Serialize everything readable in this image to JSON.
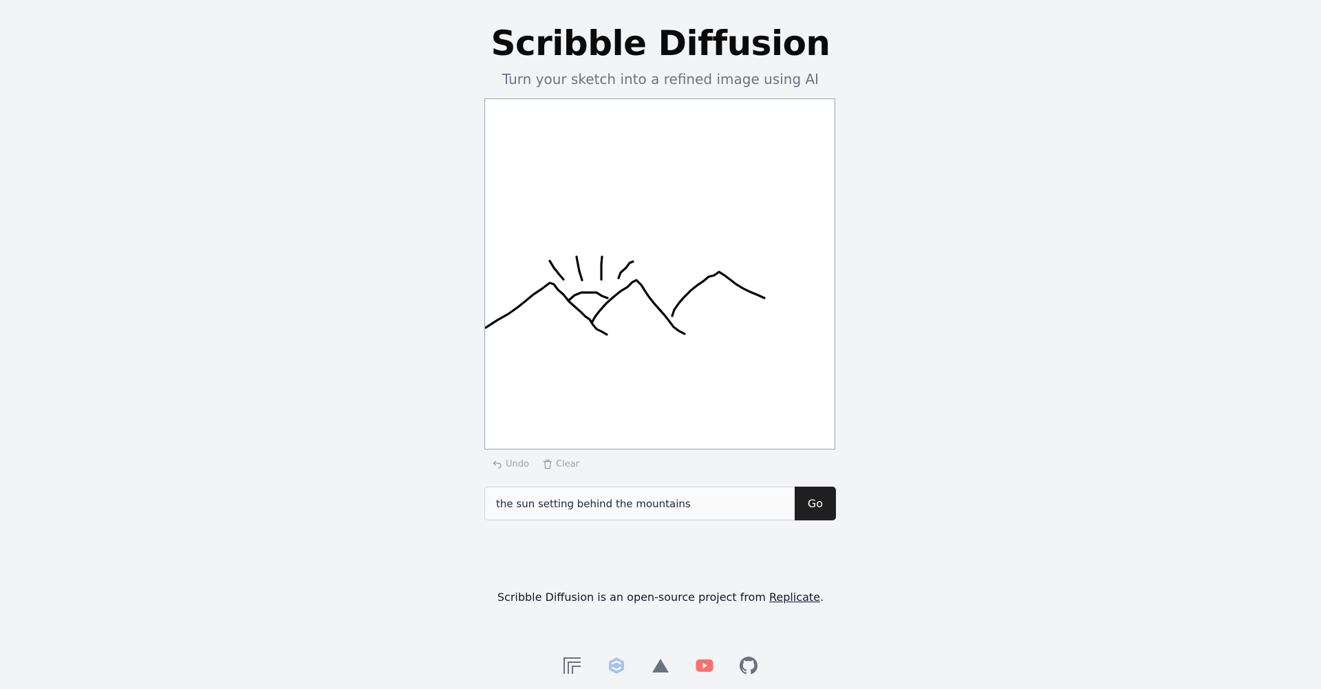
{
  "header": {
    "title": "Scribble Diffusion",
    "subtitle": "Turn your sketch into a refined image using AI"
  },
  "canvas": {
    "stroke_color": "#000000",
    "background": "#ffffff"
  },
  "tools": {
    "undo_label": "Undo",
    "clear_label": "Clear"
  },
  "prompt": {
    "value": "the sun setting behind the mountains",
    "submit_label": "Go"
  },
  "footer": {
    "text_before": "Scribble Diffusion is an open-source project from ",
    "link_label": "Replicate",
    "text_after": "."
  },
  "social_icons": [
    {
      "name": "replicate-icon",
      "color": "#6b7280"
    },
    {
      "name": "blog-icon",
      "color": "#93b4e0"
    },
    {
      "name": "vercel-icon",
      "color": "#6b7280"
    },
    {
      "name": "youtube-icon",
      "color": "#f87171"
    },
    {
      "name": "github-icon",
      "color": "#6b7280"
    }
  ]
}
